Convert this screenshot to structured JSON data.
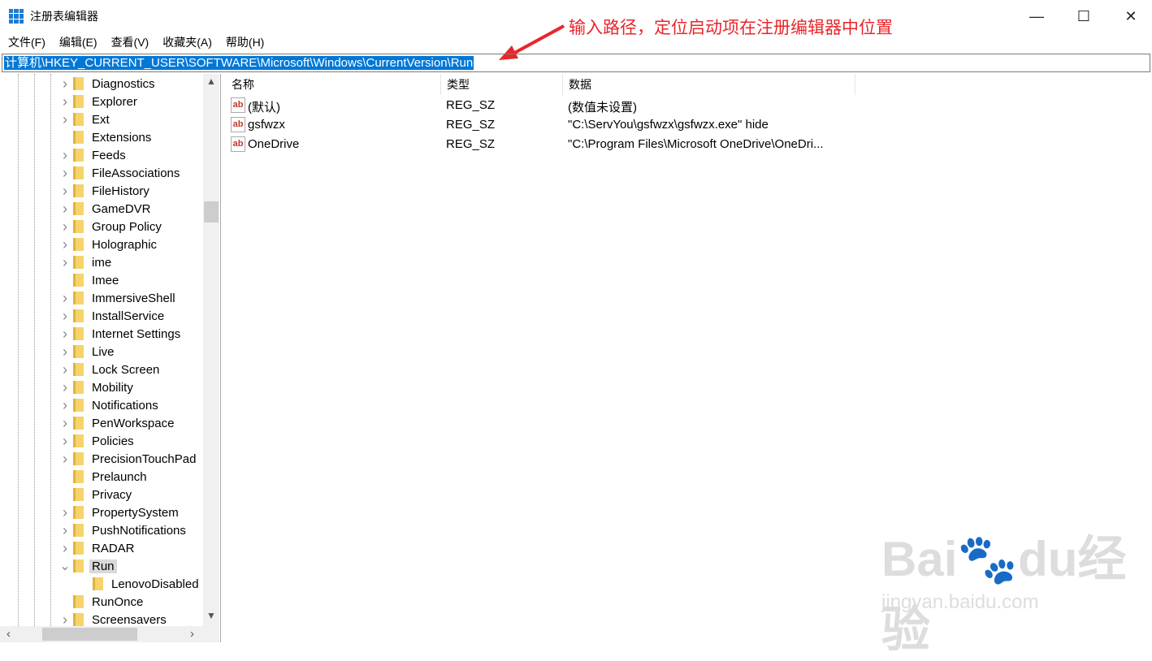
{
  "window": {
    "title": "注册表编辑器",
    "minimize": "—",
    "maximize": "☐",
    "close": "✕"
  },
  "menu": [
    "文件(F)",
    "编辑(E)",
    "查看(V)",
    "收藏夹(A)",
    "帮助(H)"
  ],
  "address": "计算机\\HKEY_CURRENT_USER\\SOFTWARE\\Microsoft\\Windows\\CurrentVersion\\Run",
  "annotation": "输入路径，定位启动项在注册编辑器中位置",
  "annotation_color": "#e8262b",
  "tree": [
    {
      "label": "Diagnostics",
      "exp": ">"
    },
    {
      "label": "Explorer",
      "exp": ">"
    },
    {
      "label": "Ext",
      "exp": ">"
    },
    {
      "label": "Extensions",
      "exp": ""
    },
    {
      "label": "Feeds",
      "exp": ">"
    },
    {
      "label": "FileAssociations",
      "exp": ">"
    },
    {
      "label": "FileHistory",
      "exp": ">"
    },
    {
      "label": "GameDVR",
      "exp": ">"
    },
    {
      "label": "Group Policy",
      "exp": ">"
    },
    {
      "label": "Holographic",
      "exp": ">"
    },
    {
      "label": "ime",
      "exp": ">"
    },
    {
      "label": "Imee",
      "exp": ""
    },
    {
      "label": "ImmersiveShell",
      "exp": ">"
    },
    {
      "label": "InstallService",
      "exp": ">"
    },
    {
      "label": "Internet Settings",
      "exp": ">"
    },
    {
      "label": "Live",
      "exp": ">"
    },
    {
      "label": "Lock Screen",
      "exp": ">"
    },
    {
      "label": "Mobility",
      "exp": ">"
    },
    {
      "label": "Notifications",
      "exp": ">"
    },
    {
      "label": "PenWorkspace",
      "exp": ">"
    },
    {
      "label": "Policies",
      "exp": ">"
    },
    {
      "label": "PrecisionTouchPad",
      "exp": ">"
    },
    {
      "label": "Prelaunch",
      "exp": ""
    },
    {
      "label": "Privacy",
      "exp": ""
    },
    {
      "label": "PropertySystem",
      "exp": ">"
    },
    {
      "label": "PushNotifications",
      "exp": ">"
    },
    {
      "label": "RADAR",
      "exp": ">"
    },
    {
      "label": "Run",
      "exp": "v",
      "selected": true
    },
    {
      "label": "LenovoDisabled",
      "exp": "",
      "child": true
    },
    {
      "label": "RunOnce",
      "exp": ""
    },
    {
      "label": "Screensavers",
      "exp": ">"
    }
  ],
  "columns": [
    "名称",
    "类型",
    "数据"
  ],
  "values": [
    {
      "name": "(默认)",
      "type": "REG_SZ",
      "data": "(数值未设置)"
    },
    {
      "name": "gsfwzx",
      "type": "REG_SZ",
      "data": "\"C:\\ServYou\\gsfwzx\\gsfwzx.exe\" hide"
    },
    {
      "name": "OneDrive",
      "type": "REG_SZ",
      "data": "\"C:\\Program Files\\Microsoft OneDrive\\OneDri..."
    }
  ],
  "watermark": {
    "brand": "Baidu经验",
    "url": "jingyan.baidu.com"
  }
}
